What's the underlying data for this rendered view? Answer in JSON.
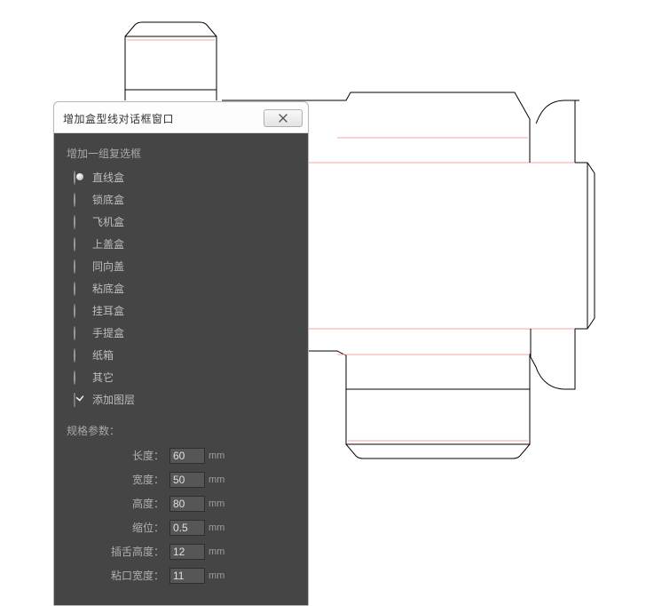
{
  "dialog": {
    "title": "增加盒型线对话框窗口",
    "group_label": "增加一组复选框",
    "options": [
      {
        "label": "直线盒",
        "checked": true
      },
      {
        "label": "锁底盒",
        "checked": false
      },
      {
        "label": "飞机盒",
        "checked": false
      },
      {
        "label": "上盖盒",
        "checked": false
      },
      {
        "label": "同向盖",
        "checked": false
      },
      {
        "label": "粘底盒",
        "checked": false
      },
      {
        "label": "挂耳盒",
        "checked": false
      },
      {
        "label": "手提盒",
        "checked": false
      },
      {
        "label": "纸箱",
        "checked": false
      },
      {
        "label": "其它",
        "checked": false
      }
    ],
    "checkbox": {
      "label": "添加图层",
      "checked": true
    },
    "params_label": "规格参数：",
    "params": [
      {
        "label": "长度：",
        "value": "60",
        "unit": "mm"
      },
      {
        "label": "宽度：",
        "value": "50",
        "unit": "mm"
      },
      {
        "label": "高度：",
        "value": "80",
        "unit": "mm"
      },
      {
        "label": "缩位：",
        "value": "0.5",
        "unit": "mm"
      },
      {
        "label": "插舌高度：",
        "value": "12",
        "unit": "mm"
      },
      {
        "label": "粘口宽度：",
        "value": "11",
        "unit": "mm"
      }
    ]
  },
  "chart_data": {
    "type": "diagram",
    "description": "box dieline (tuck-end carton unfolded template)",
    "cut_stroke": "#000000",
    "fold_stroke": "#f4a6aa",
    "dims_mm": {
      "length": 60,
      "width": 50,
      "height": 80,
      "inset": 0.5,
      "tuck_height": 12,
      "glue_width": 11
    }
  }
}
